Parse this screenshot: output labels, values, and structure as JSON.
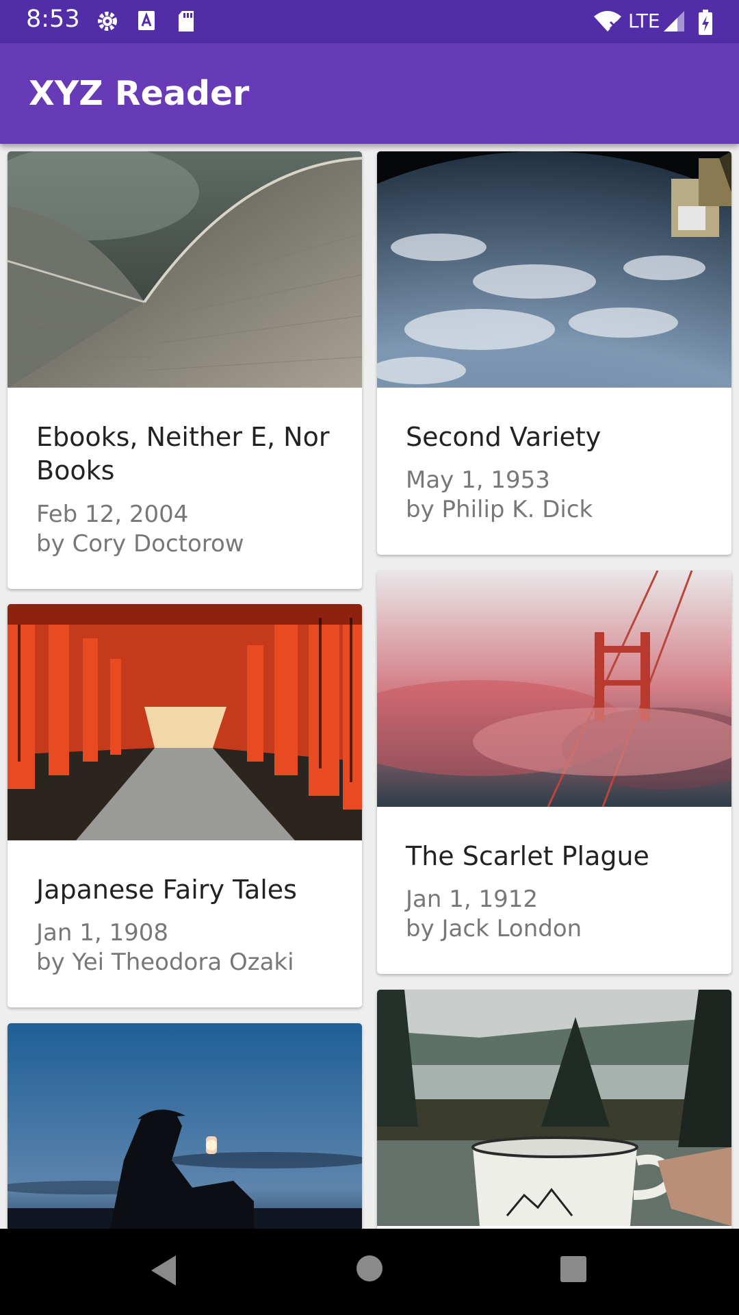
{
  "status_bar": {
    "time": "8:53",
    "network": "LTE",
    "left_icons": [
      "gear-icon",
      "font-icon",
      "sd-card-icon"
    ],
    "right_icons": [
      "wifi-icon",
      "signal-icon",
      "battery-charging-icon"
    ]
  },
  "app_bar": {
    "title": "XYZ Reader"
  },
  "colors": {
    "primary": "#673ab7",
    "primary_dark": "#512da8",
    "background": "#eeeeee"
  },
  "articles": [
    {
      "title": "Ebooks, Neither E, Nor Books",
      "date": "Feb 12, 2004",
      "author": "by Cory Doctorow",
      "image": "opera-house-roof-photo"
    },
    {
      "title": "Second Variety",
      "date": "May 1, 1953",
      "author": "by Philip K. Dick",
      "image": "earth-from-space-photo"
    },
    {
      "title": "Japanese Fairy Tales",
      "date": "Jan 1, 1908",
      "author": "by Yei Theodora Ozaki",
      "image": "torii-gates-photo"
    },
    {
      "title": "The Scarlet Plague",
      "date": "Jan 1, 1912",
      "author": "by Jack London",
      "image": "bridge-in-red-fog-photo"
    },
    {
      "title": "",
      "date": "",
      "author": "",
      "image": "lantern-silhouette-photo"
    },
    {
      "title": "",
      "date": "",
      "author": "",
      "image": "adventure-mug-lake-photo"
    }
  ],
  "nav_bar": {
    "icons": [
      "back-icon",
      "home-icon",
      "recents-icon"
    ]
  }
}
